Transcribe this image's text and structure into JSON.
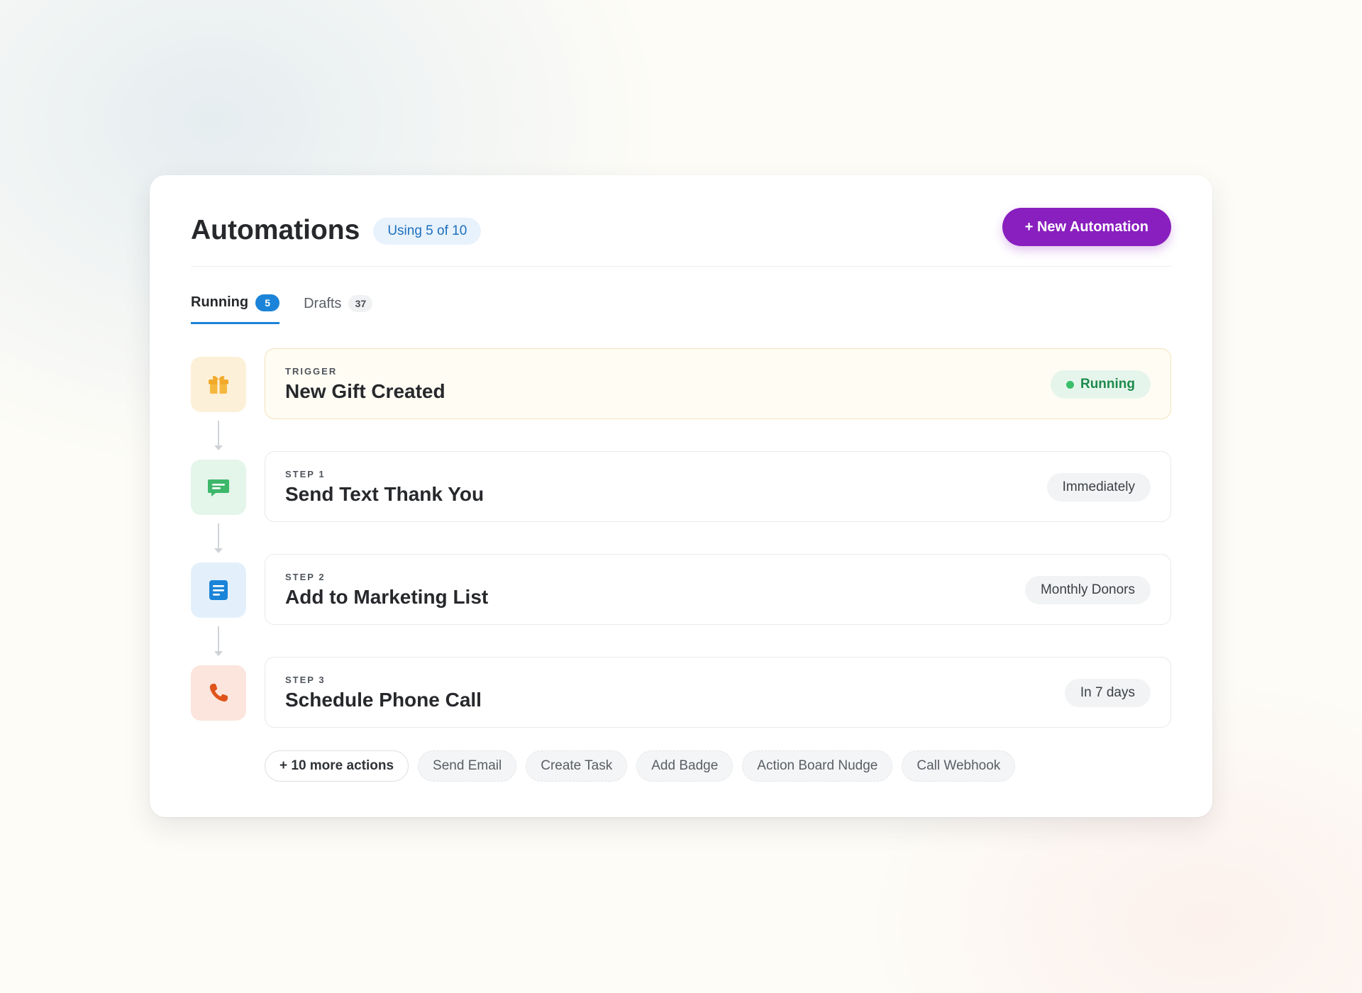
{
  "header": {
    "title": "Automations",
    "usage_badge": "Using 5 of 10",
    "new_button_label": "+ New Automation"
  },
  "tabs": [
    {
      "label": "Running",
      "count": "5",
      "active": true
    },
    {
      "label": "Drafts",
      "count": "37",
      "active": false
    }
  ],
  "flow": {
    "trigger": {
      "kicker": "TRIGGER",
      "title": "New Gift Created",
      "status": "Running",
      "icon": "gift-icon",
      "tile_color": "#fdf0d8",
      "icon_color": "#f2aa2a",
      "status_color": "#1f8a4c"
    },
    "steps": [
      {
        "kicker": "STEP 1",
        "title": "Send Text Thank You",
        "timing": "Immediately",
        "icon": "message-icon",
        "tile_color": "#e4f5ea",
        "icon_color": "#3db86b"
      },
      {
        "kicker": "STEP 2",
        "title": "Add to Marketing List",
        "timing": "Monthly Donors",
        "icon": "list-icon",
        "tile_color": "#e3f0fc",
        "icon_color": "#1b84d8"
      },
      {
        "kicker": "STEP 3",
        "title": "Schedule Phone Call",
        "timing": "In 7 days",
        "icon": "phone-icon",
        "tile_color": "#fbe5dc",
        "icon_color": "#e0531b"
      }
    ]
  },
  "actions": {
    "more_label": "+ 10 more actions",
    "items": [
      "Send Email",
      "Create Task",
      "Add Badge",
      "Action Board Nudge",
      "Call Webhook"
    ]
  },
  "colors": {
    "brand": "#8a1fbf",
    "tab_accent": "#1b84d8"
  }
}
